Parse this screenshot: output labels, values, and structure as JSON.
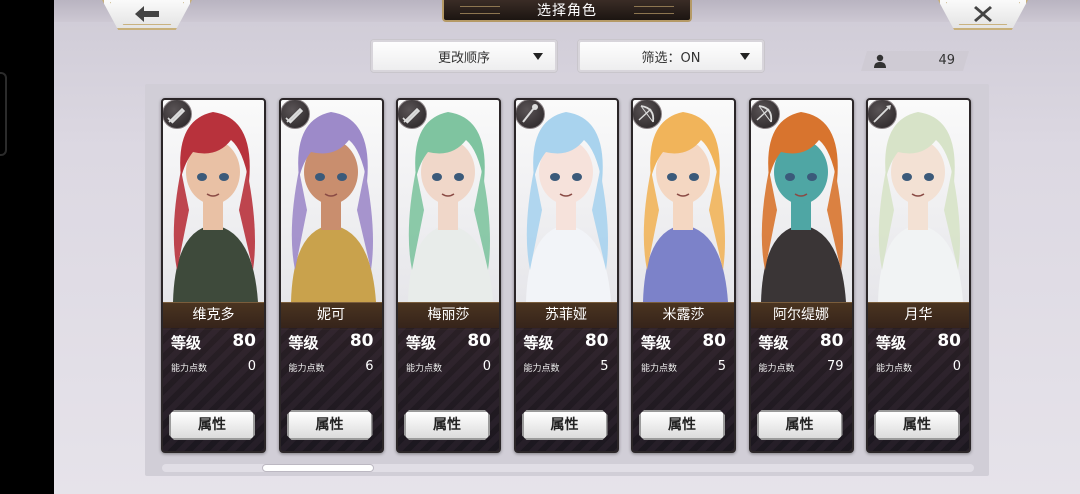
{
  "title": "选择角色",
  "header": {
    "back_icon": "arrow-left-icon",
    "close_icon": "close-x-icon"
  },
  "controls": {
    "sort_label": "更改顺序",
    "filter_label": "筛选：ON",
    "count": "49"
  },
  "labels": {
    "level": "等级",
    "ability_points": "能力点数",
    "attribute_button": "属性"
  },
  "characters": [
    {
      "name": "维克多",
      "level": "80",
      "ability_points": "0",
      "class_icon": "sword-icon",
      "hair": "#b8323c",
      "skin": "#e9c1a5",
      "outfit": "#3e4a3b"
    },
    {
      "name": "妮可",
      "level": "80",
      "ability_points": "6",
      "class_icon": "sword-icon",
      "hair": "#9d8ac9",
      "skin": "#c98e6e",
      "outfit": "#c9a24c"
    },
    {
      "name": "梅丽莎",
      "level": "80",
      "ability_points": "0",
      "class_icon": "sword-icon",
      "hair": "#7fc4a0",
      "skin": "#f0d7c9",
      "outfit": "#e8ecea"
    },
    {
      "name": "苏菲娅",
      "level": "80",
      "ability_points": "5",
      "class_icon": "staff-icon",
      "hair": "#a9d3ee",
      "skin": "#f6e2db",
      "outfit": "#f2f4f8"
    },
    {
      "name": "米露莎",
      "level": "80",
      "ability_points": "5",
      "class_icon": "bow-icon",
      "hair": "#f1b45a",
      "skin": "#f4d7c2",
      "outfit": "#7c82c9"
    },
    {
      "name": "阿尔缇娜",
      "level": "80",
      "ability_points": "79",
      "class_icon": "bow-icon",
      "hair": "#d8742e",
      "skin": "#4fa6a4",
      "outfit": "#3a3536"
    },
    {
      "name": "月华",
      "level": "80",
      "ability_points": "0",
      "class_icon": "spear-icon",
      "hair": "#d7e3c8",
      "skin": "#f3e1d4",
      "outfit": "#f1f3f4"
    }
  ],
  "colors": {
    "accent_gold": "#b59a66",
    "panel": "#d1ced7",
    "card_dark": "#3b3134"
  }
}
